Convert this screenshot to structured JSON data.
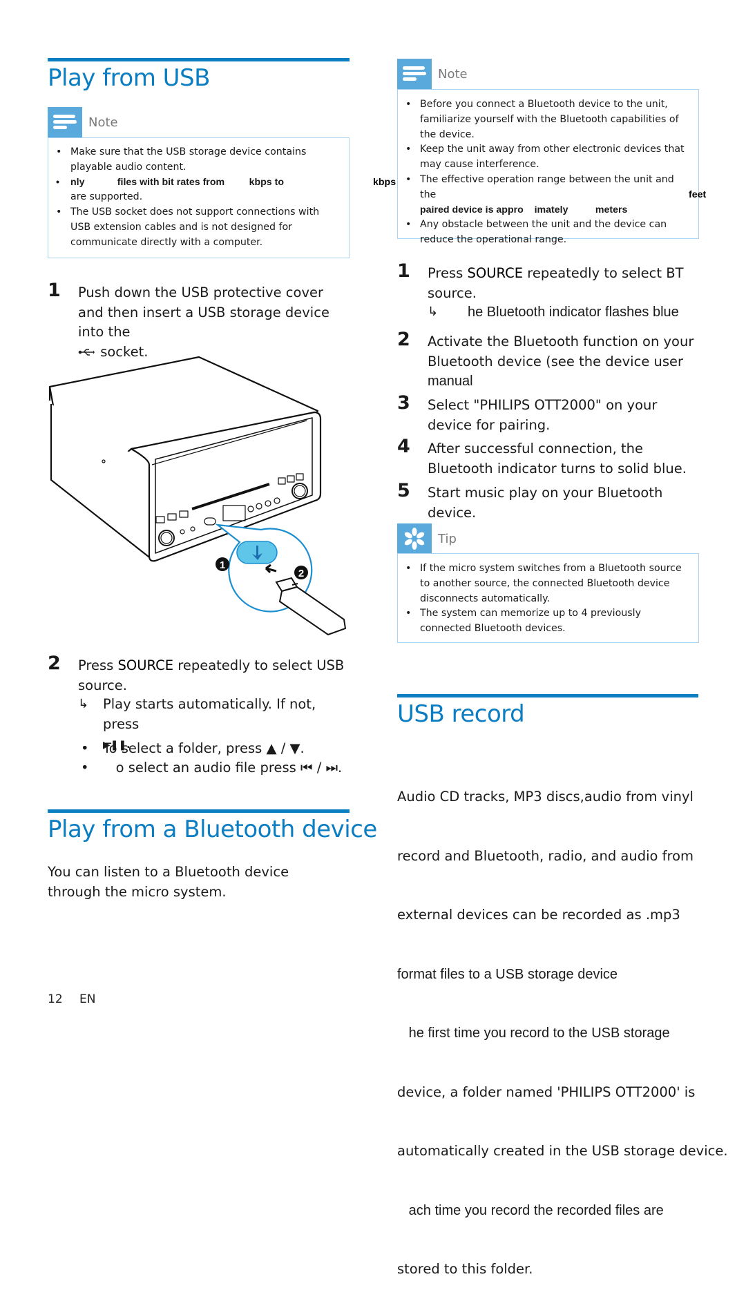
{
  "colors": {
    "accent_blue": "#0b7dc2",
    "callout_icon_bg": "#5aa9dc",
    "callout_border": "#a9d3ee",
    "usb_highlight": "#5fc6ea"
  },
  "left": {
    "section1": {
      "title": "Play from USB",
      "note": {
        "label": "Note",
        "icon": "note-lines-icon",
        "items": [
          "Make sure that the USB storage device contains playable audio content.",
          "nly            files with bit rates from         kbps to",
          "The USB socket does not support connections with USB extension cables and is not designed for communicate directly with a computer."
        ],
        "item2_line2": "are supported."
      },
      "step1": {
        "num": "1",
        "text": "Push down the USB protective cover and then insert a USB storage device into the",
        "icon": "usb-icon",
        "tail": "socket."
      },
      "illustration": {
        "callout1": "1",
        "callout2": "2"
      },
      "step2": {
        "num": "2",
        "pre": "Press ",
        "keyword": "SOURCE",
        "post": " repeatedly to select USB source.",
        "result_arrow": "↳",
        "result": "Play starts automatically. If not, press",
        "result_icon": "▶❚❚.",
        "bullets": [
          {
            "text": "To select a folder, press ",
            "icons": "▲ / ▼."
          },
          {
            "text": "   o select an audio file press ",
            "icons": "⏮ / ⏭."
          }
        ]
      }
    },
    "section2": {
      "title": "Play from a Bluetooth device",
      "body": "You can listen to a Bluetooth device through the micro system."
    },
    "footer": {
      "page": "12",
      "lang": "EN"
    }
  },
  "right": {
    "note": {
      "label": "Note",
      "icon": "note-lines-icon",
      "stray_kbps": "kbps",
      "items": [
        "Before you connect a Bluetooth device to the unit, familiarize yourself with the Bluetooth capabilities of the device.",
        "Keep the unit away from other electronic devices that may cause interference.",
        "The effective operation range between the unit and the",
        "Any obstacle between the unit and the device can reduce the operational range."
      ],
      "item3_line2": "paired device is appro    imately          meters",
      "item3_feet": "feet"
    },
    "steps": [
      {
        "num": "1",
        "pre": "Press ",
        "keyword": "SOURCE",
        "post": " repeatedly to select BT source."
      },
      {
        "num": "2",
        "text": "Activate the Bluetooth function on your Bluetooth device (see the device user",
        "tail": "manual"
      },
      {
        "num": "3",
        "text": "Select \"PHILIPS OTT2000\" on your device for pairing."
      },
      {
        "num": "4",
        "text": "After successful connection, the Bluetooth indicator turns to solid blue."
      },
      {
        "num": "5",
        "text": "Start music play on your Bluetooth device."
      }
    ],
    "step1_result_arrow": "↳",
    "step1_result": "he Bluetooth indicator flashes blue",
    "tip": {
      "label": "Tip",
      "icon": "asterisk-tip-icon",
      "items": [
        "If the micro system switches from a Bluetooth source to another source, the connected Bluetooth device disconnects automatically.",
        "The system can memorize up to 4 previously connected Bluetooth devices."
      ]
    },
    "section3": {
      "title": "USB record",
      "lines": [
        "Audio CD tracks, MP3 discs,audio from vinyl",
        "record and Bluetooth, radio, and audio from",
        "external devices can be recorded as .mp3",
        "format files to a USB storage device",
        "   he first time you record to the USB storage",
        "device, a folder named 'PHILIPS OTT2000' is",
        "automatically created in the USB storage device.",
        "   ach time you record the recorded files are",
        "stored to this folder."
      ]
    }
  }
}
